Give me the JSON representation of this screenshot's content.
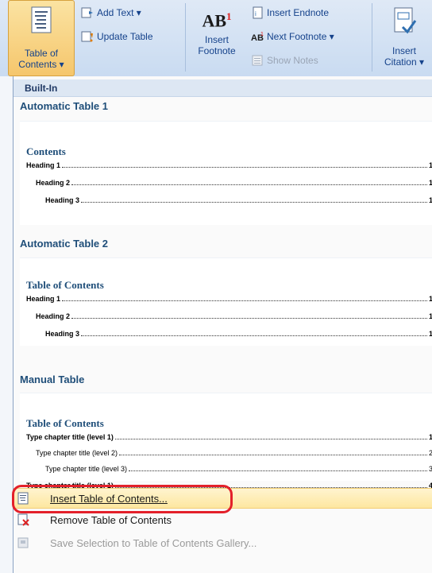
{
  "ribbon": {
    "toc_button": {
      "label_line1": "Table of",
      "label_line2": "Contents ▾"
    },
    "add_text": "Add Text ▾",
    "update_table": "Update Table",
    "insert_footnote": {
      "icon_text": "AB",
      "superscript": "1",
      "label_line1": "Insert",
      "label_line2": "Footnote"
    },
    "insert_endnote": "Insert Endnote",
    "next_footnote": "Next Footnote ▾",
    "show_notes": "Show Notes",
    "insert_citation": {
      "label_line1": "Insert",
      "label_line2": "Citation ▾"
    }
  },
  "menu": {
    "builtin_header": "Built-In",
    "items": [
      {
        "title": "Automatic Table 1",
        "heading": "Contents",
        "lines": [
          {
            "text": "Heading 1",
            "page": "1"
          },
          {
            "text": "Heading 2",
            "page": "1"
          },
          {
            "text": "Heading 3",
            "page": "1"
          }
        ]
      },
      {
        "title": "Automatic Table 2",
        "heading": "Table of Contents",
        "lines": [
          {
            "text": "Heading 1",
            "page": "1"
          },
          {
            "text": "Heading 2",
            "page": "1"
          },
          {
            "text": "Heading 3",
            "page": "1"
          }
        ]
      },
      {
        "title": "Manual Table",
        "heading": "Table of Contents",
        "lines": [
          {
            "text": "Type chapter title (level 1)",
            "page": "1"
          },
          {
            "text": "Type chapter title (level 2)",
            "page": "2"
          },
          {
            "text": "Type chapter title (level 3)",
            "page": "3"
          },
          {
            "text": "Type chapter title (level 1)",
            "page": "4"
          }
        ]
      }
    ],
    "commands": {
      "insert": "Insert Table of Contents...",
      "remove": "Remove Table of Contents",
      "save": "Save Selection to Table of Contents Gallery..."
    }
  },
  "colors": {
    "highlight": "#fde7a0",
    "annotation": "#e3202a",
    "accent": "#1f4e79"
  }
}
